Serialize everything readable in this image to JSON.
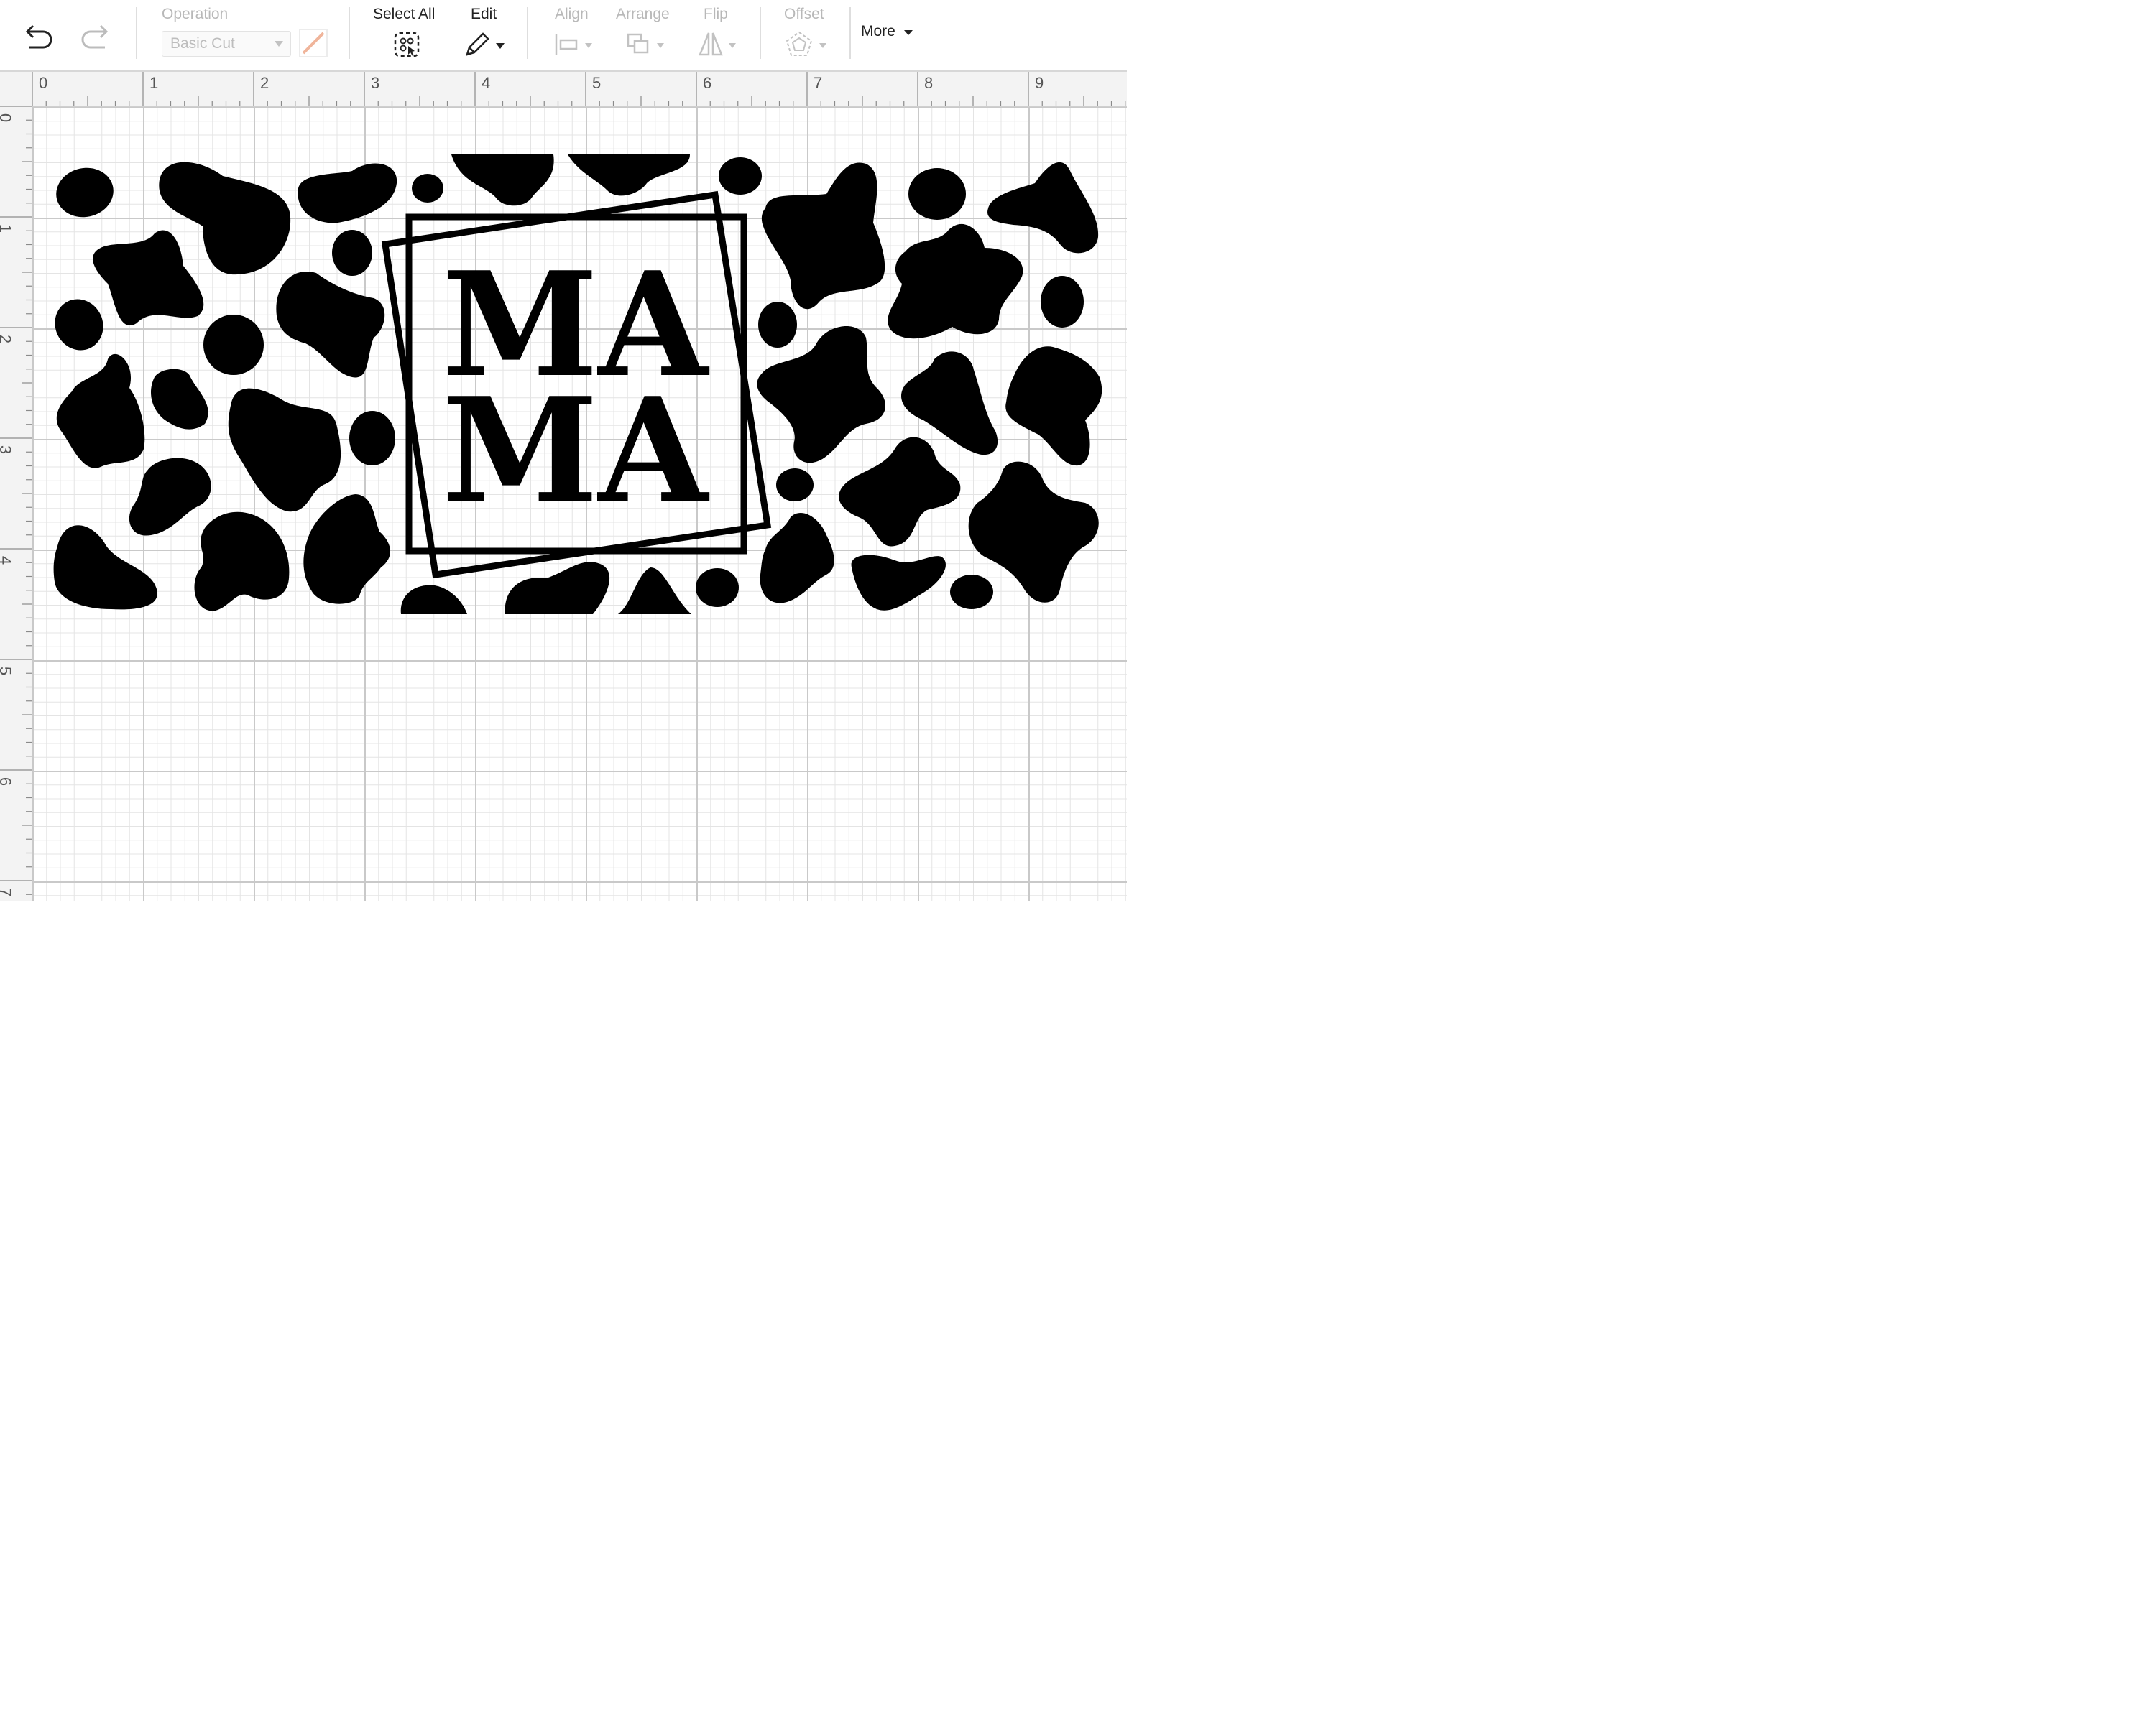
{
  "toolbar": {
    "operation_label": "Operation",
    "operation_value": "Basic Cut",
    "select_all_label": "Select All",
    "edit_label": "Edit",
    "align_label": "Align",
    "arrange_label": "Arrange",
    "flip_label": "Flip",
    "offset_label": "Offset",
    "more_label": "More"
  },
  "ruler": {
    "horizontal": [
      "0",
      "1",
      "2",
      "3",
      "4",
      "5",
      "6",
      "7",
      "8",
      "9"
    ],
    "vertical": [
      "0",
      "1",
      "2",
      "3",
      "4",
      "5",
      "6",
      "7"
    ]
  },
  "design": {
    "text_line1": "MA",
    "text_line2": "MA",
    "ink_color": "#000000"
  },
  "colors": {
    "accent_line": "#f0b59b",
    "disabled": "#b8b8b8",
    "grid_major": "#c9c9c9",
    "grid_minor": "#e4e4e4"
  }
}
